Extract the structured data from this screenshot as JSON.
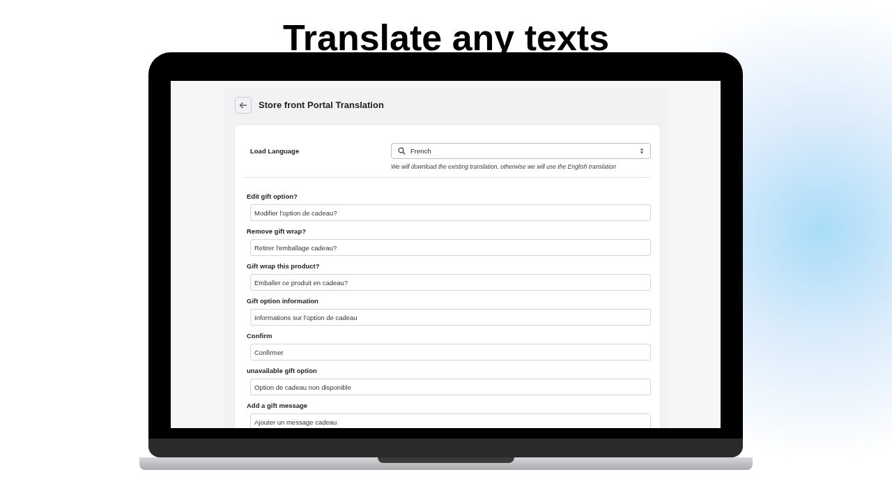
{
  "headline": "Translate any texts",
  "page": {
    "title": "Store front Portal Translation"
  },
  "language": {
    "label": "Load Language",
    "value": "French",
    "hint": "We will download the existing translation, otherwise we will use the English translation"
  },
  "fields": [
    {
      "label": "Edit gift option?",
      "value": "Modifier l'option de cadeau?"
    },
    {
      "label": "Remove gift wrap?",
      "value": "Retirer l'emballage cadeau?"
    },
    {
      "label": "Gift wrap this product?",
      "value": "Emballer ce produit en cadeau?"
    },
    {
      "label": "Gift option information",
      "value": "Informations sur l'option de cadeau"
    },
    {
      "label": "Confirm",
      "value": "Confirmer"
    },
    {
      "label": "unavailable gift option",
      "value": "Option de cadeau non disponible"
    },
    {
      "label": "Add a gift message",
      "value": "Ajouter un message cadeau"
    }
  ]
}
